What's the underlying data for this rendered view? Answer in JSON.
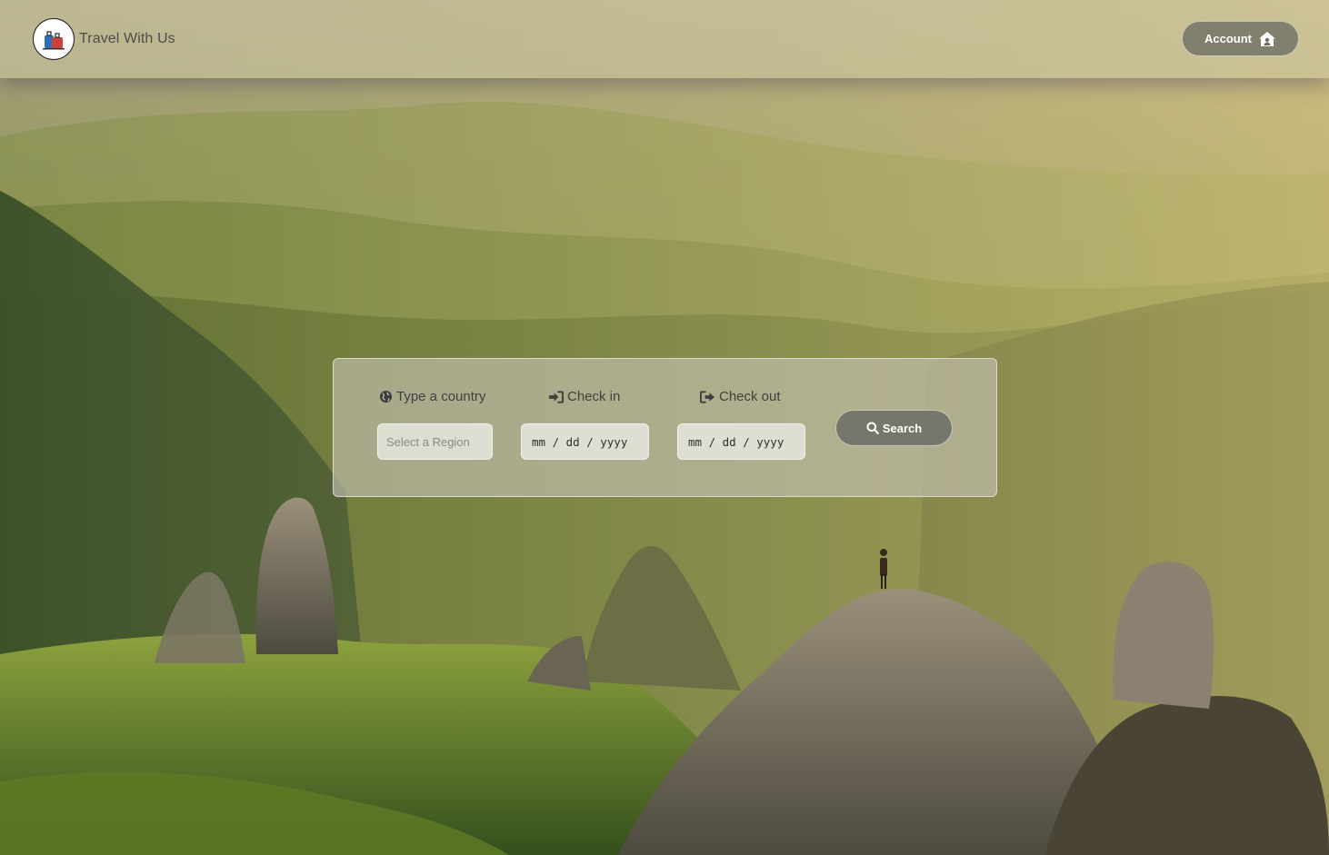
{
  "navbar": {
    "brand": "Travel With Us",
    "account_label": "Account",
    "logo_icon": "luggage-icon",
    "account_icon": "house-user-icon"
  },
  "search": {
    "country_label": "Type a country",
    "country_placeholder": "Select a Region",
    "checkin_label": "Check in",
    "checkin_placeholder": "mm / dd / yyyy",
    "checkout_label": "Check out",
    "checkout_placeholder": "mm / dd / yyyy",
    "button_label": "Search",
    "country_icon": "globe-icon",
    "checkin_icon": "sign-in-icon",
    "checkout_icon": "sign-out-icon",
    "button_icon": "search-icon"
  },
  "colors": {
    "navbar": "#cdc8a5",
    "panel": "#c6c4b6",
    "button": "#707068"
  }
}
